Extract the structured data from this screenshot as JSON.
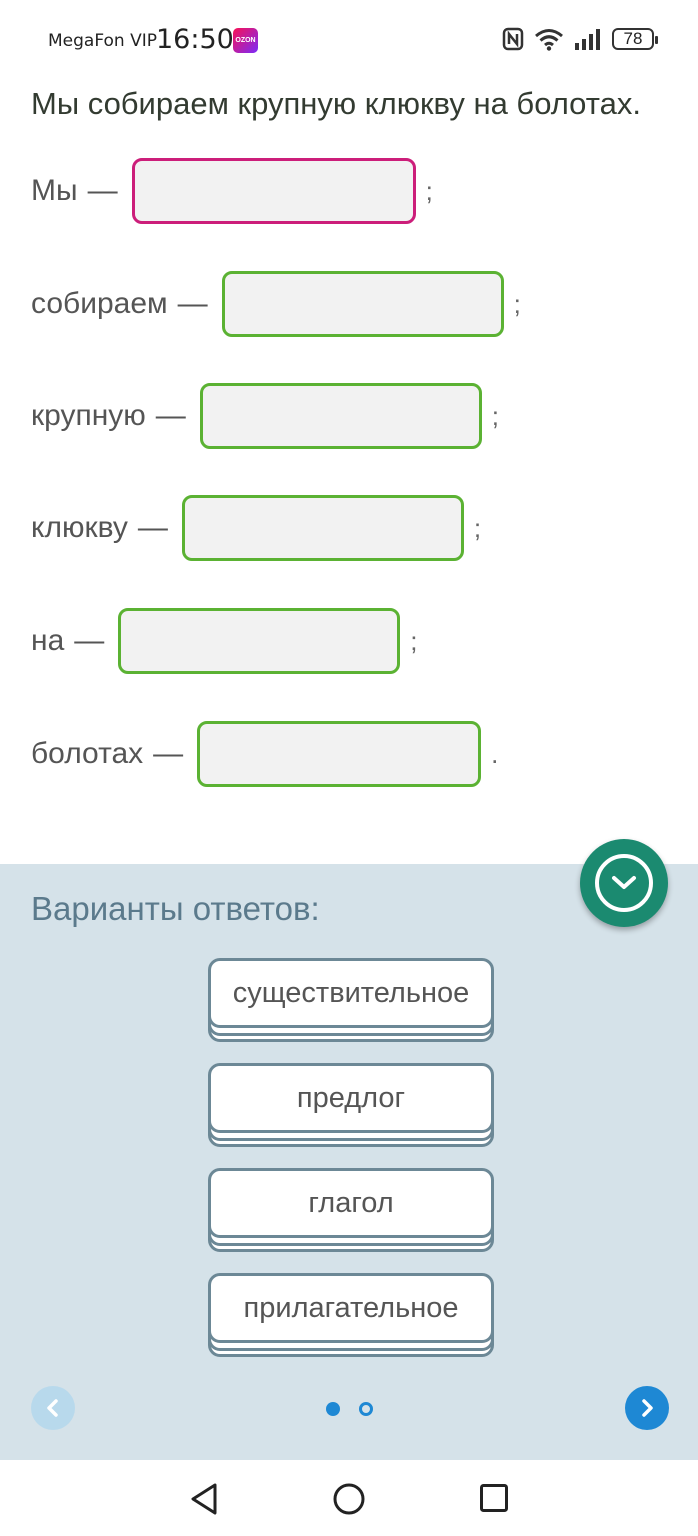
{
  "status_bar": {
    "carrier": "MegaFon VIP",
    "time": "16:50",
    "app_badge": "OZON",
    "battery": "78",
    "icons": [
      "nfc-icon",
      "wifi-icon",
      "signal-icon",
      "battery-icon"
    ]
  },
  "question": {
    "sentence": "Мы собираем крупную клюкву на болотах.",
    "rows": [
      {
        "word": "Мы",
        "dash": "—",
        "value": "",
        "punct": ";",
        "active": true
      },
      {
        "word": "собираем",
        "dash": "—",
        "value": "",
        "punct": ";",
        "active": false
      },
      {
        "word": "крупную",
        "dash": "—",
        "value": "",
        "punct": ";",
        "active": false
      },
      {
        "word": "клюкву",
        "dash": "—",
        "value": "",
        "punct": ";",
        "active": false
      },
      {
        "word": "на",
        "dash": "—",
        "value": "",
        "punct": ";",
        "active": false
      },
      {
        "word": "болотах",
        "dash": "—",
        "value": "",
        "punct": ".",
        "active": false
      }
    ]
  },
  "answers": {
    "title": "Варианты ответов:",
    "options": [
      "существительное",
      "предлог",
      "глагол",
      "прилагательное"
    ]
  },
  "pager": {
    "current_page": 1,
    "total_pages": 2
  },
  "colors": {
    "active_border": "#cc1e7a",
    "slot_border": "#5bb233",
    "panel_bg": "#d5e2e9",
    "accent_blue": "#1e88d4",
    "collapse_green": "#1b8a70"
  }
}
